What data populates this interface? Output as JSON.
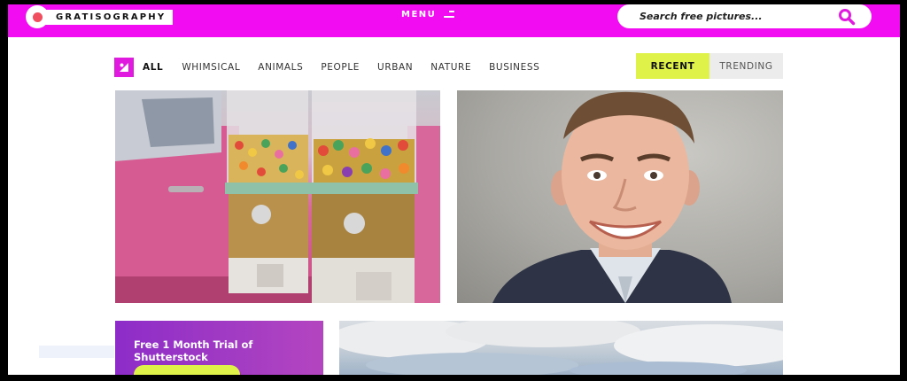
{
  "header": {
    "logo_text": "GRATISOGRAPHY",
    "menu_label": "MENU",
    "search_placeholder": "Search free pictures..."
  },
  "filters": {
    "categories": [
      {
        "label": "ALL",
        "active": true
      },
      {
        "label": "WHIMSICAL",
        "active": false
      },
      {
        "label": "ANIMALS",
        "active": false
      },
      {
        "label": "PEOPLE",
        "active": false
      },
      {
        "label": "URBAN",
        "active": false
      },
      {
        "label": "NATURE",
        "active": false
      },
      {
        "label": "BUSINESS",
        "active": false
      }
    ],
    "sort": {
      "recent": "RECENT",
      "trending": "TRENDING",
      "selected": "RECENT"
    }
  },
  "photos": [
    {
      "name": "gumball-machines-photo"
    },
    {
      "name": "smiling-man-photo"
    },
    {
      "name": "cloudy-sky-photo"
    }
  ],
  "promo": {
    "title": "Free 1 Month Trial of Shutterstock"
  },
  "colors": {
    "brand": "#f20cf2",
    "accent": "#dff24a",
    "promo": "#8d2cc8"
  },
  "icons": {
    "logo": "logo-dot-icon",
    "menu": "menu-icon",
    "search": "search-icon",
    "all": "all-photos-icon"
  }
}
